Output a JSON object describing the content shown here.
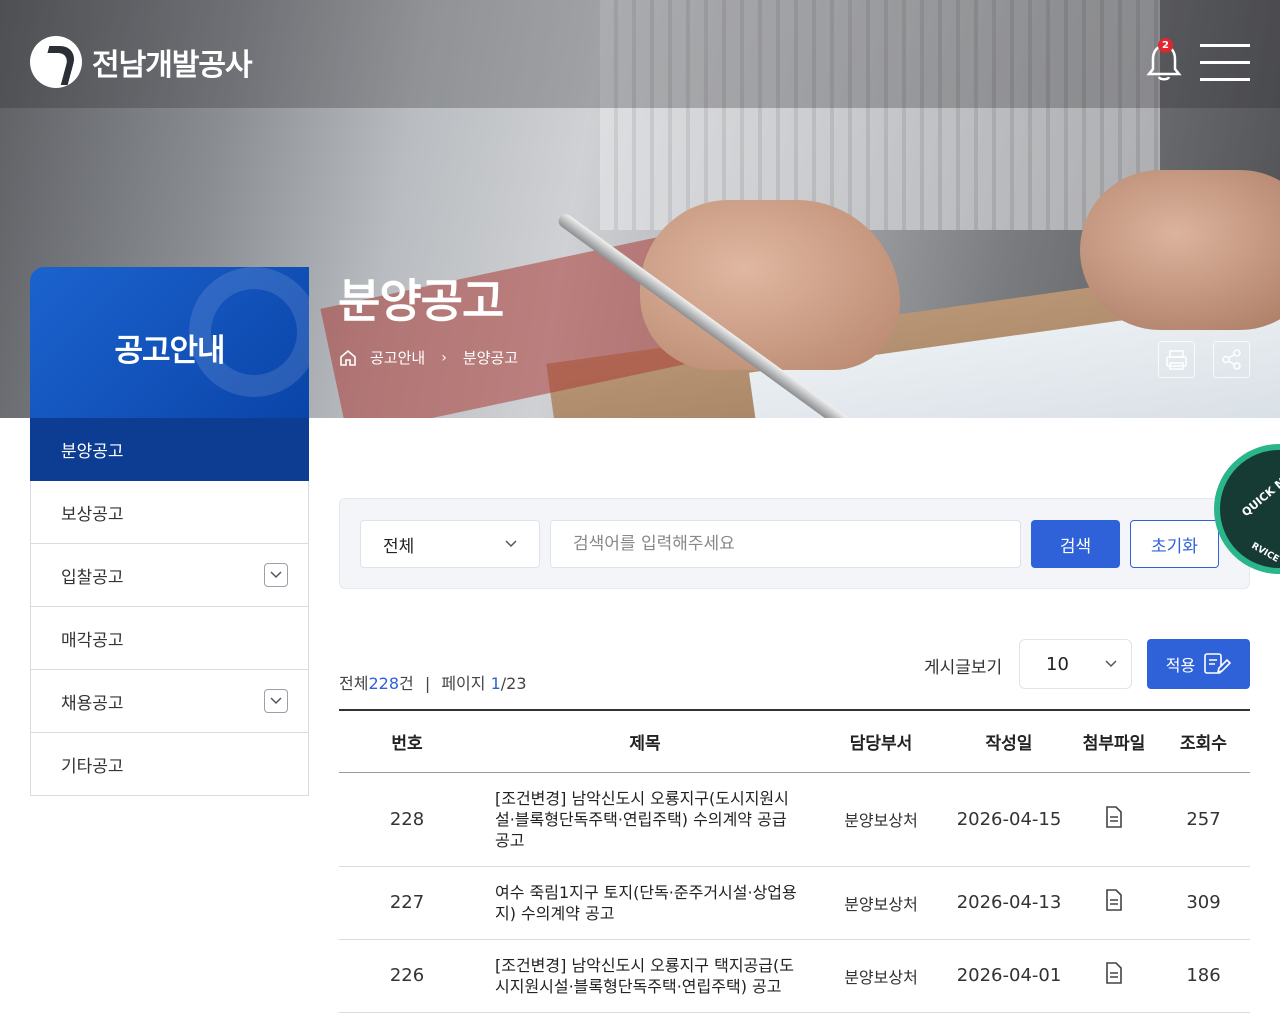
{
  "header": {
    "logo_text": "전남개발공사",
    "notification_count": "2"
  },
  "sidebar": {
    "title": "공고안내",
    "items": [
      {
        "label": "분양공고",
        "active": true
      },
      {
        "label": "보상공고"
      },
      {
        "label": "입찰공고",
        "expandable": true
      },
      {
        "label": "매각공고"
      },
      {
        "label": "채용공고",
        "expandable": true
      },
      {
        "label": "기타공고"
      }
    ]
  },
  "page": {
    "title": "분양공고",
    "breadcrumb": [
      "공고안내",
      "분양공고"
    ]
  },
  "search": {
    "category": "전체",
    "placeholder": "검색어를 입력해주세요",
    "search_label": "검색",
    "reset_label": "초기화"
  },
  "quick_menu": {
    "line1": "QUICK MENU SE",
    "line2": "RVICE"
  },
  "list": {
    "summary_prefix": "전체",
    "total": "228",
    "total_suffix": "건",
    "divider": "|",
    "page_label": "페이지",
    "page_current": "1",
    "page_total": "/23",
    "per_page_label": "게시글보기",
    "per_page": "10",
    "apply_label": "적용"
  },
  "table": {
    "headers": [
      "번호",
      "제목",
      "담당부서",
      "작성일",
      "첨부파일",
      "조회수"
    ],
    "rows": [
      {
        "no": "228",
        "title": "[조건변경] 남악신도시 오룡지구(도시지원시설·블록형단독주택·연립주택) 수의계약 공급 공고",
        "dept": "분양보상처",
        "date": "2026-04-15",
        "views": "257"
      },
      {
        "no": "227",
        "title": "여수 죽림1지구 토지(단독·준주거시설·상업용지) 수의계약 공고",
        "dept": "분양보상처",
        "date": "2026-04-13",
        "views": "309"
      },
      {
        "no": "226",
        "title": "[조건변경] 남악신도시 오룡지구 택지공급(도시지원시설·블록형단독주택·연립주택) 공고",
        "dept": "분양보상처",
        "date": "2026-04-01",
        "views": "186"
      }
    ]
  },
  "colors": {
    "primary": "#2f62d8",
    "sidebar_active": "#0d3d93"
  }
}
